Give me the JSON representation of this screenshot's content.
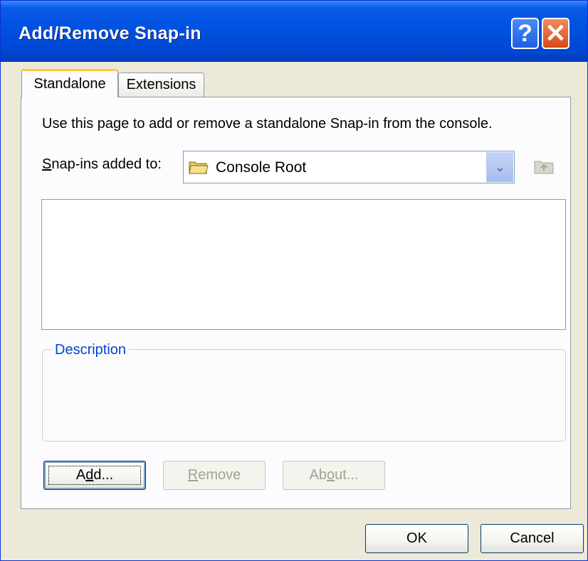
{
  "window": {
    "title": "Add/Remove Snap-in",
    "help_label": "?",
    "close_label": "✕"
  },
  "tabs": [
    {
      "label": "Standalone",
      "selected": true
    },
    {
      "label": "Extensions",
      "selected": false
    }
  ],
  "standalone": {
    "intro_text": "Use this page to add or remove a standalone Snap-in from the console.",
    "snapins_label_prefix": "S",
    "snapins_label_rest": "nap-ins added to:",
    "combo_value": "Console Root",
    "combo_arrow": "⌄",
    "snapin_list": [],
    "description_title": "Description",
    "description_text": "",
    "add_label_prefix": "A",
    "add_label_underline": "d",
    "add_label_suffix": "d...",
    "remove_label_underline": "R",
    "remove_label_rest": "emove",
    "about_label_prefix": "Ab",
    "about_label_underline": "o",
    "about_label_suffix": "ut..."
  },
  "footer": {
    "ok_label": "OK",
    "cancel_label": "Cancel"
  },
  "icons": {
    "combo": "folder-icon",
    "up": "folder-up-icon"
  },
  "colors": {
    "titlebar": "#0054e3",
    "dialog_face": "#ece9d8",
    "group_title": "#0046d5",
    "active_tab_accent": "#ffc83c"
  }
}
